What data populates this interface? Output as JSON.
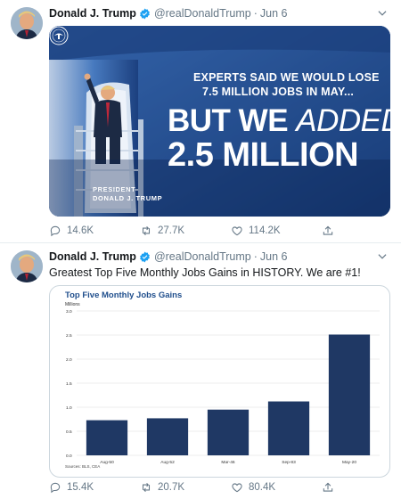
{
  "tweets": [
    {
      "author_name": "Donald J. Trump",
      "handle": "@realDonaldTrump",
      "separator": "·",
      "time": "Jun 6",
      "media": {
        "line1": "EXPERTS SAID WE WOULD LOSE",
        "line2": "7.5 MILLION JOBS IN MAY...",
        "line3_bold": "BUT WE ",
        "line3_light": "ADDED",
        "line4": "2.5 MILLION",
        "president_label": "PRESIDENT",
        "president_name": "DONALD J. TRUMP"
      },
      "stats": {
        "replies": "14.6K",
        "retweets": "27.7K",
        "likes": "114.2K"
      }
    },
    {
      "author_name": "Donald J. Trump",
      "handle": "@realDonaldTrump",
      "separator": "·",
      "time": "Jun 6",
      "text": "Greatest Top Five Monthly Jobs Gains in HISTORY. We are #1!",
      "stats": {
        "replies": "15.4K",
        "retweets": "20.7K",
        "likes": "80.4K"
      }
    }
  ],
  "icons": {
    "verified": "verified-badge-icon",
    "caret": "chevron-down-icon",
    "reply": "reply-icon",
    "retweet": "retweet-icon",
    "like": "heart-icon",
    "share": "share-icon"
  },
  "colors": {
    "verified_blue": "#1da1f2",
    "icon_gray": "#657786",
    "chart_bar": "#1f3864",
    "chart_title": "#1f4e8c"
  },
  "chart_data": {
    "type": "bar",
    "title": "Top Five Monthly Jobs Gains",
    "ylabel": "Millions",
    "xlabel": "",
    "categories": [
      "Aug-50",
      "Aug-52",
      "Mar-46",
      "Sep-83",
      "May-20"
    ],
    "values": [
      0.73,
      0.77,
      0.95,
      1.12,
      2.51
    ],
    "ylim": [
      0,
      3.0
    ],
    "yticks": [
      "0.0",
      "0.5",
      "1.0",
      "1.5",
      "2.0",
      "2.5",
      "3.0"
    ],
    "grid": true,
    "source": "Sources: BLS, CEA"
  }
}
